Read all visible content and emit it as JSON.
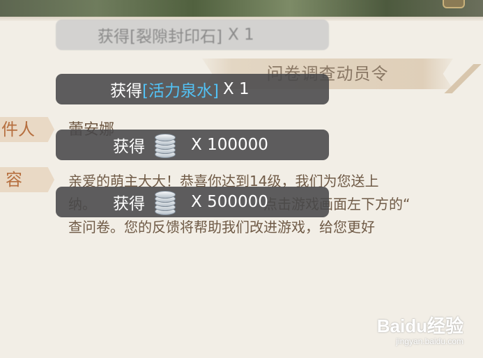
{
  "mail": {
    "title": "问卷调查动员令",
    "sender_label": "件人",
    "sender_name": "蕾安娜",
    "content_label": "容",
    "content_lines": [
      "亲爱的萌主大大！恭喜你达到14级，我们为您送上",
      "纳。",
      "查问卷。您的反馈将帮助我们改进游戏，给您更好"
    ],
    "content_line2_tail": "点击游戏画面左下方的“"
  },
  "toasts": [
    {
      "prefix": "获得",
      "item": "[裂隙封印石]",
      "count": "X 1",
      "faded": true
    },
    {
      "prefix": "获得",
      "item": "[活力泉水]",
      "count": "X 1",
      "faded": false
    },
    {
      "prefix": "获得",
      "icon": "silver-coin-icon",
      "count": "X 100000",
      "faded": false
    },
    {
      "prefix": "获得",
      "icon": "silver-coin-icon",
      "count": "X 500000",
      "faded": false
    }
  ],
  "watermark": {
    "brand": "Baidu经验",
    "url": "jingyan.baidu.com"
  }
}
